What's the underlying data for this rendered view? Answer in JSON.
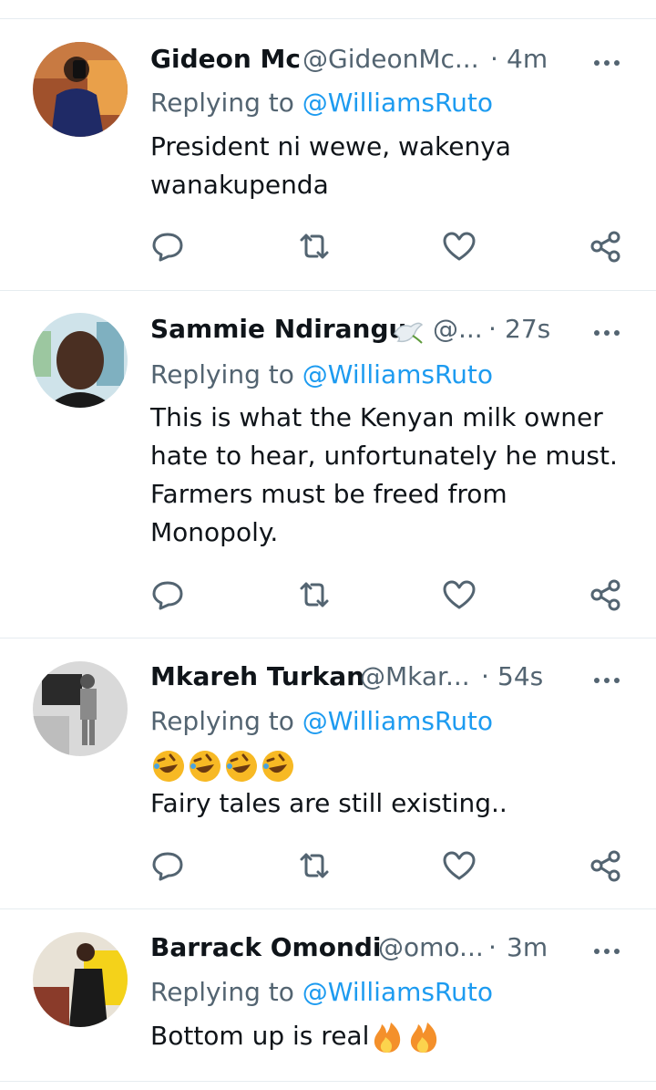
{
  "reply_prefix": "Replying to",
  "tweets": [
    {
      "name": "Gideon Mc",
      "handle": "@GideonMc...",
      "separator": "·",
      "time": "4m",
      "replying_to": "@WilliamsRuto",
      "text_lines": [
        "President ni wewe, wakenya",
        "wanakupenda"
      ]
    },
    {
      "name": "Sammie Ndirangu",
      "handle": "@...",
      "separator": "·",
      "time": "27s",
      "replying_to": "@WilliamsRuto",
      "text_lines": [
        "This is what the Kenyan milk owner",
        "hate to hear, unfortunately he must.",
        "Farmers must be freed from",
        "Monopoly."
      ]
    },
    {
      "name": "Mkareh Turkan",
      "handle": "@Mkar...",
      "separator": "·",
      "time": "54s",
      "replying_to": "@WilliamsRuto",
      "text_lines": [
        "",
        "Fairy tales are still existing.."
      ]
    },
    {
      "name": "Barrack Omondi",
      "handle": "@omo...",
      "separator": "·",
      "time": "3m",
      "replying_to": "@WilliamsRuto",
      "text_lines": [
        "Bottom up is real"
      ]
    }
  ],
  "icons": {
    "more": "more-horizontal-icon",
    "reply": "speech-bubble-icon",
    "retweet": "retweet-arrows-icon",
    "like": "heart-outline-icon",
    "share": "share-nodes-icon",
    "dove": "dove-emoji-icon",
    "laugh": "rolling-on-floor-laughing-emoji-icon",
    "fire": "fire-emoji-icon"
  },
  "colors": {
    "link": "#1d9bf0",
    "secondary_text": "#536471",
    "primary_text": "#0f1419",
    "divider": "#e6ecf0"
  }
}
